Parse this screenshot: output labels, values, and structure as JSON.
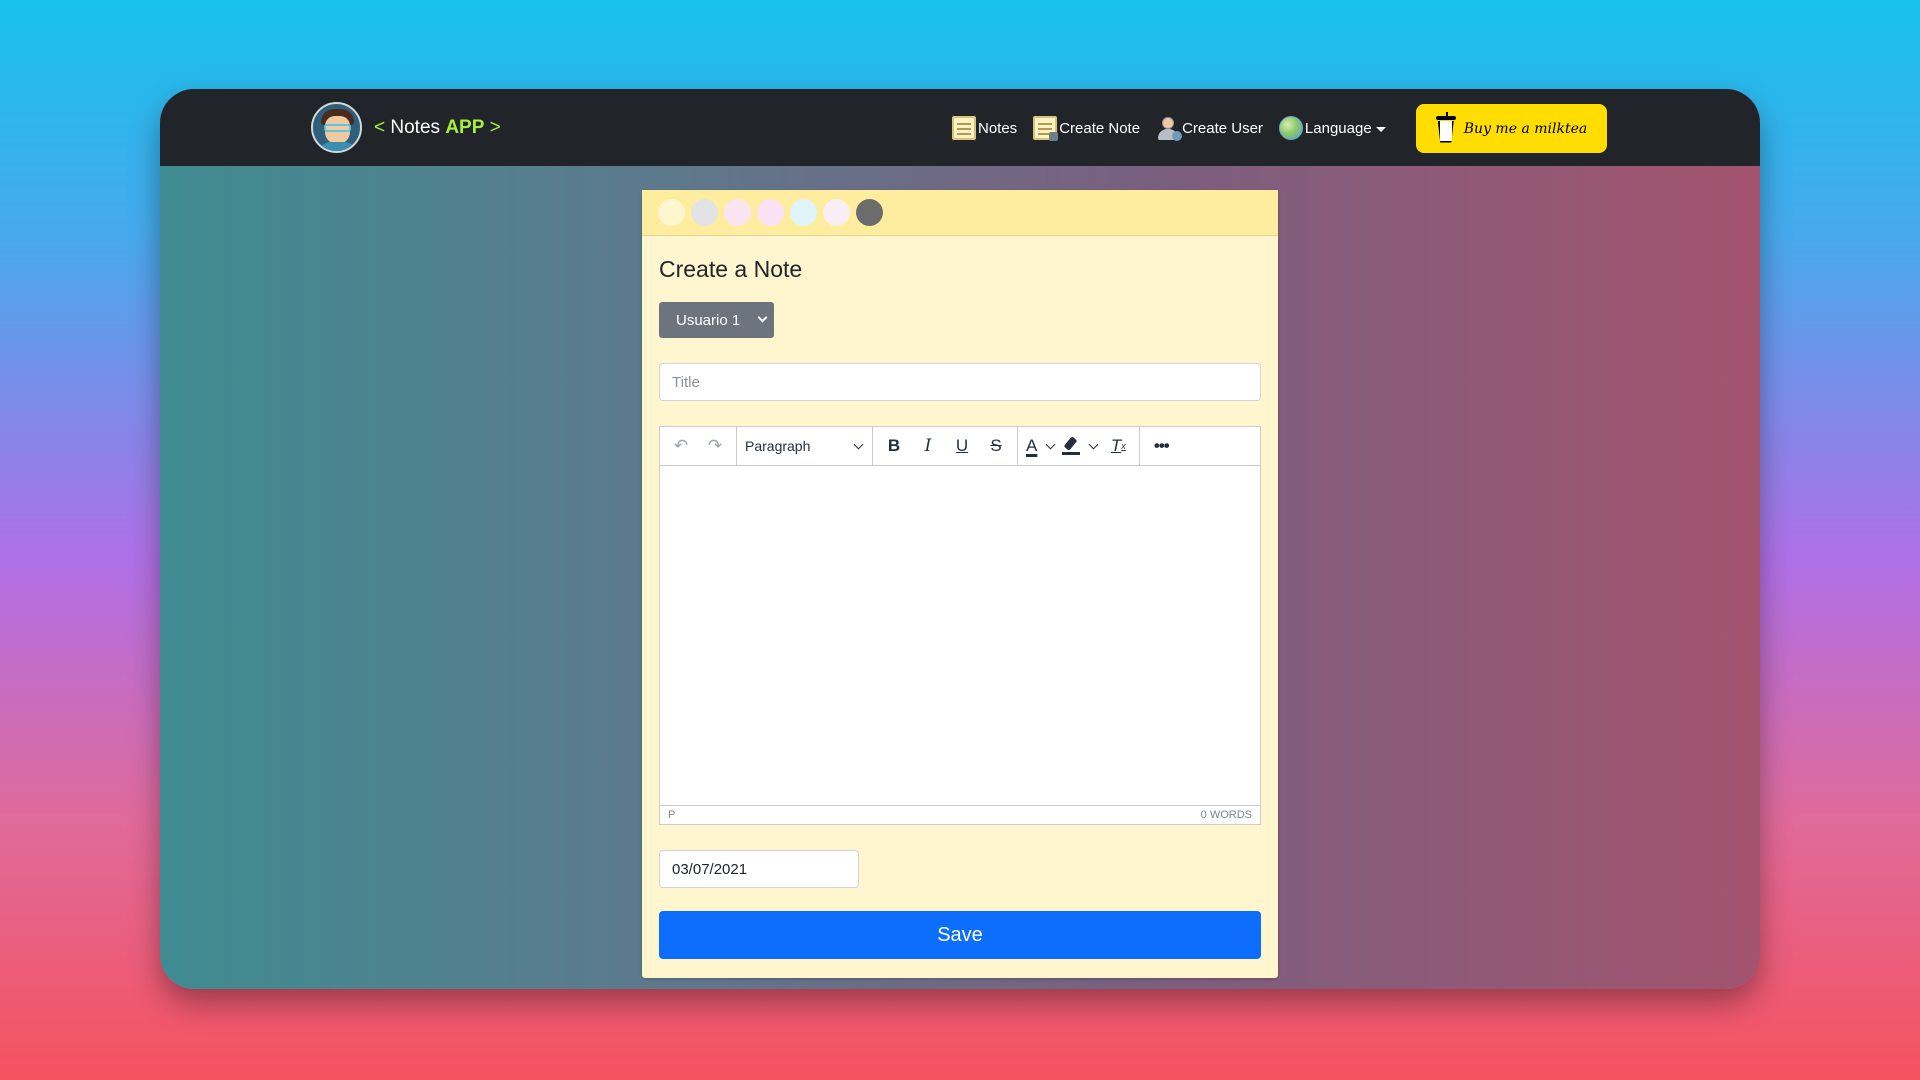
{
  "navbar": {
    "brand": {
      "open": "<",
      "name": "Notes",
      "app": "APP",
      "close": ">"
    },
    "links": [
      {
        "label": "Notes",
        "icon": "note-icon"
      },
      {
        "label": "Create Note",
        "icon": "create-note-icon"
      },
      {
        "label": "Create User",
        "icon": "user-add-icon"
      },
      {
        "label": "Language",
        "icon": "globe-icon"
      }
    ],
    "milktea_label": "Buy me a milktea"
  },
  "card": {
    "swatches": [
      "#fff6cf",
      "#e2e3e5",
      "#fbe4f1",
      "#fae1f4",
      "#dff4fb",
      "#f9eef4",
      "#6c6c6c"
    ],
    "title": "Create a Note",
    "user_select": "Usuario 1",
    "title_placeholder": "Title",
    "editor": {
      "block_format": "Paragraph",
      "status_path": "P",
      "word_count": "0 WORDS"
    },
    "date_value": "03/07/2021",
    "save_label": "Save"
  },
  "colors": {
    "navbar": "#212529",
    "brand_accent": "#a6f03b",
    "milktea_button": "#ffdd00",
    "card_bg": "#fff6cf",
    "card_header": "#ffed9f",
    "select_bg": "#6c757d",
    "save_button": "#0d6efd"
  }
}
